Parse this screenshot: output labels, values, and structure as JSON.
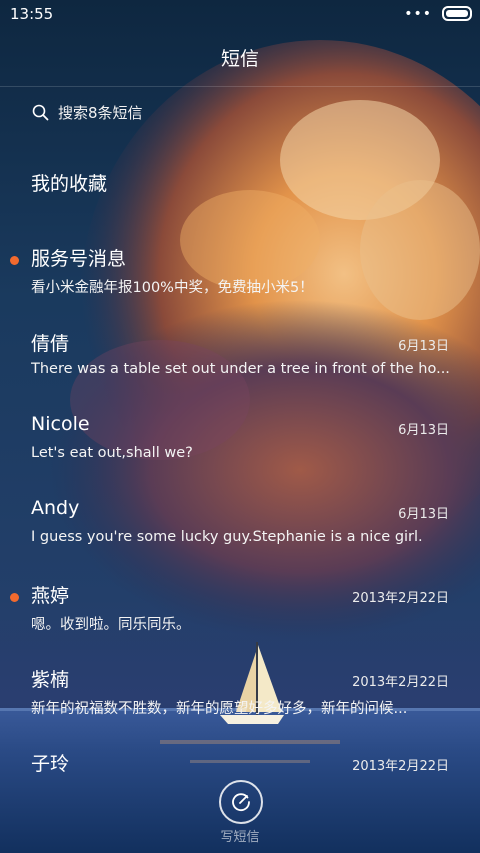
{
  "status_bar": {
    "time": "13:55",
    "more": "•••"
  },
  "header": {
    "title": "短信"
  },
  "search": {
    "placeholder": "搜索8条短信"
  },
  "favorites": {
    "label": "我的收藏"
  },
  "threads": [
    {
      "name": "服务号消息",
      "date": "",
      "snippet": "看小米金融年报100%中奖，免费抽小米5！",
      "unread": true
    },
    {
      "name": "倩倩",
      "date": "6月13日",
      "snippet": "There was a table set out under a tree in front of the ho...",
      "unread": false
    },
    {
      "name": "Nicole",
      "date": "6月13日",
      "snippet": "Let's eat out,shall we?",
      "unread": false
    },
    {
      "name": "Andy",
      "date": "6月13日",
      "snippet": "I guess you're some lucky guy.Stephanie is a nice girl.",
      "unread": false
    },
    {
      "name": "燕婷",
      "date": "2013年2月22日",
      "snippet": "嗯。收到啦。同乐同乐。",
      "unread": true
    },
    {
      "name": "紫楠",
      "date": "2013年2月22日",
      "snippet": "新年的祝福数不胜数，新年的愿望好多好多，新年的问候...",
      "unread": false
    },
    {
      "name": "子玲",
      "date": "2013年2月22日",
      "snippet": "",
      "unread": false
    }
  ],
  "compose": {
    "label": "写短信"
  },
  "colors": {
    "unread_dot": "#f26a2e",
    "sky_top": "#0e2740",
    "sea": "#12345e"
  }
}
